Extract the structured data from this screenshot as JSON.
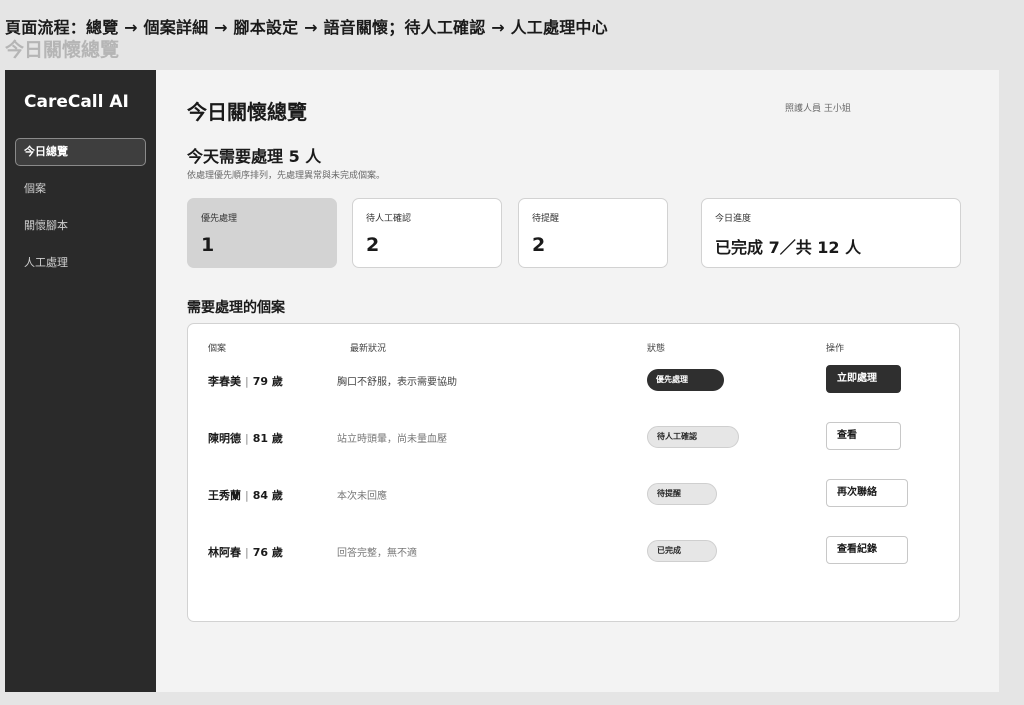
{
  "flow": {
    "title": "頁面流程：總覽 → 個案詳細 → 腳本設定 → 語音關懷；待人工確認 → 人工處理中心",
    "subtitle": "今日關懷總覽"
  },
  "sidebar": {
    "brand": "CareCall AI",
    "items": [
      {
        "label": "今日總覽",
        "active": true
      },
      {
        "label": "個案",
        "active": false
      },
      {
        "label": "關懷腳本",
        "active": false
      },
      {
        "label": "人工處理",
        "active": false
      }
    ]
  },
  "header": {
    "title": "今日關懷總覽",
    "user": "照護人員 王小姐"
  },
  "summary": {
    "headline": "今天需要處理 5 人",
    "hint": "依處理優先順序排列，先處理異常與未完成個案。"
  },
  "cards": [
    {
      "label": "優先處理",
      "value": "1"
    },
    {
      "label": "待人工確認",
      "value": "2"
    },
    {
      "label": "待提醒",
      "value": "2"
    },
    {
      "label": "今日進度",
      "value": "已完成 7／共 12 人"
    }
  ],
  "cases_section": {
    "title": "需要處理的個案",
    "columns": [
      "個案",
      "最新狀況",
      "狀態",
      "操作"
    ],
    "rows": [
      {
        "name": "李春美",
        "age": "79 歲",
        "latest": "胸口不舒服，表示需要協助",
        "status": "優先處理",
        "action": "立即處理"
      },
      {
        "name": "陳明德",
        "age": "81 歲",
        "latest": "站立時頭暈，尚未量血壓",
        "status": "待人工確認",
        "action": "查看"
      },
      {
        "name": "王秀蘭",
        "age": "84 歲",
        "latest": "本次未回應",
        "status": "待提醒",
        "action": "再次聯絡"
      },
      {
        "name": "林阿春",
        "age": "76 歲",
        "latest": "回答完整，無不適",
        "status": "已完成",
        "action": "查看紀錄"
      }
    ],
    "separator": "|"
  },
  "colors": {
    "sidebar_bg": "#2a2a2a",
    "accent_dark": "#2f2f2f",
    "highlight_card": "#d3d3d3",
    "page_bg": "#f3f3f3"
  }
}
